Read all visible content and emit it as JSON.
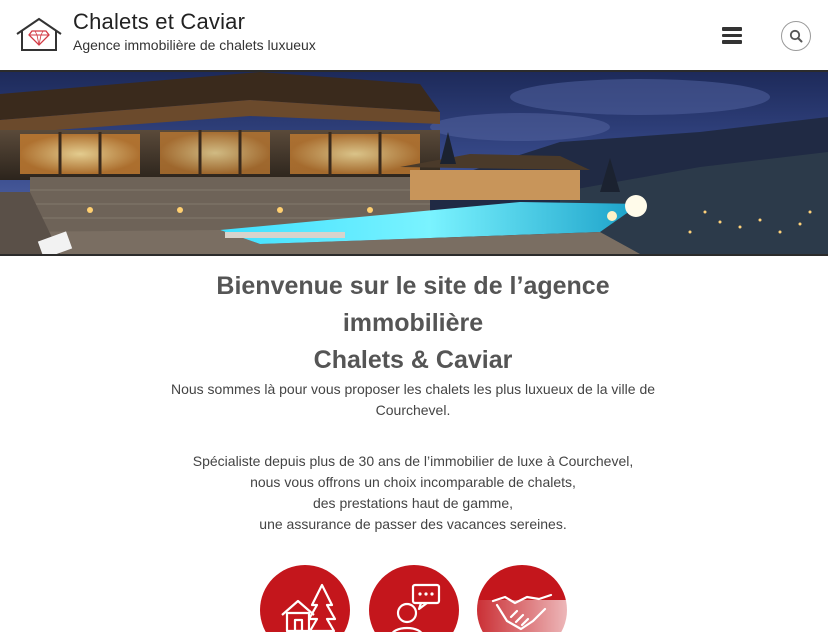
{
  "header": {
    "title": "Chalets et Caviar",
    "subtitle": "Agence immobilière de chalets luxueux",
    "menu_icon": "hamburger-icon",
    "search_icon": "search-icon",
    "logo_icon": "house-diamond-icon"
  },
  "hero": {
    "image": "luxury-chalet-pool-night-photo"
  },
  "main": {
    "welcome_line1": "Bienvenue sur le site de l’agence",
    "welcome_line2": "immobilière",
    "welcome_line3": "Chalets & Caviar",
    "intro": "Nous sommes là pour vous proposer les chalets les plus luxueux de la ville de Courchevel.",
    "spec_line1": "Spécialiste depuis plus de 30 ans de l’immobilier de luxe à Courchevel,",
    "spec_line2": "nous vous offrons un choix incomparable de chalets,",
    "spec_line3": "des prestations haut de gamme,",
    "spec_line4": "une assurance de passer des vacances sereines."
  },
  "features": [
    {
      "icon": "chalet-tree-icon"
    },
    {
      "icon": "person-chat-icon"
    },
    {
      "icon": "handshake-icon"
    }
  ],
  "colors": {
    "accent": "#c4161c",
    "text": "#555555",
    "rule": "#2b2b2b"
  }
}
